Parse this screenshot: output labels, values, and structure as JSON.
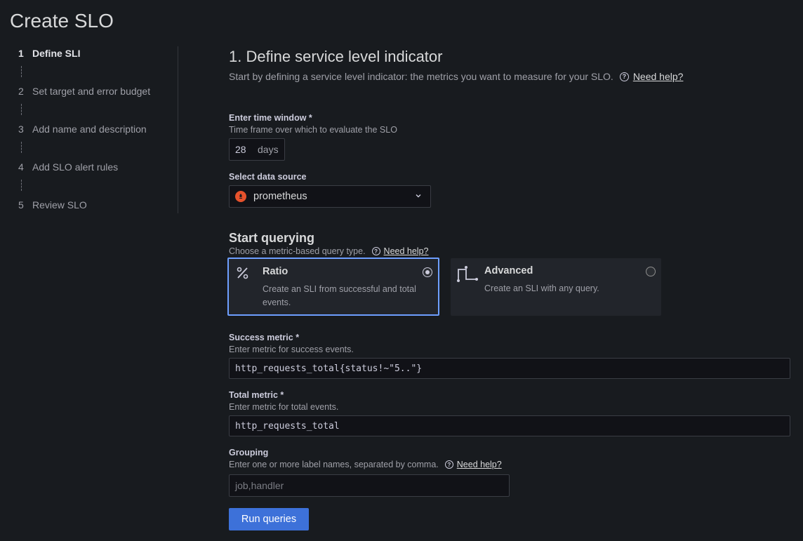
{
  "page": {
    "title": "Create SLO"
  },
  "stepper": {
    "steps": [
      {
        "num": "1",
        "label": "Define SLI"
      },
      {
        "num": "2",
        "label": "Set target and error budget"
      },
      {
        "num": "3",
        "label": "Add name and description"
      },
      {
        "num": "4",
        "label": "Add SLO alert rules"
      },
      {
        "num": "5",
        "label": "Review SLO"
      }
    ]
  },
  "main": {
    "heading": "1. Define service level indicator",
    "subtitle": "Start by defining a service level indicator: the metrics you want to measure for your SLO.",
    "help_link": "Need help?"
  },
  "time_window": {
    "label": "Enter time window *",
    "description": "Time frame over which to evaluate the SLO",
    "value": "28",
    "unit": "days"
  },
  "data_source": {
    "label": "Select data source",
    "value": "prometheus"
  },
  "querying": {
    "heading": "Start querying",
    "description": "Choose a metric-based query type.",
    "help_link": "Need help?",
    "options": [
      {
        "title": "Ratio",
        "description": "Create an SLI from successful and total events.",
        "selected": true
      },
      {
        "title": "Advanced",
        "description": "Create an SLI with any query.",
        "selected": false
      }
    ]
  },
  "success_metric": {
    "label": "Success metric *",
    "description": "Enter metric for success events.",
    "value": "http_requests_total{status!~\"5..\"}"
  },
  "total_metric": {
    "label": "Total metric *",
    "description": "Enter metric for total events.",
    "value": "http_requests_total"
  },
  "grouping": {
    "label": "Grouping",
    "description": "Enter one or more label names, separated by comma.",
    "help_link": "Need help?",
    "placeholder": "job,handler"
  },
  "actions": {
    "run_queries": "Run queries"
  },
  "colors": {
    "accent": "#3d71d9",
    "selected_border": "#6e9fff",
    "background": "#181b1f"
  }
}
